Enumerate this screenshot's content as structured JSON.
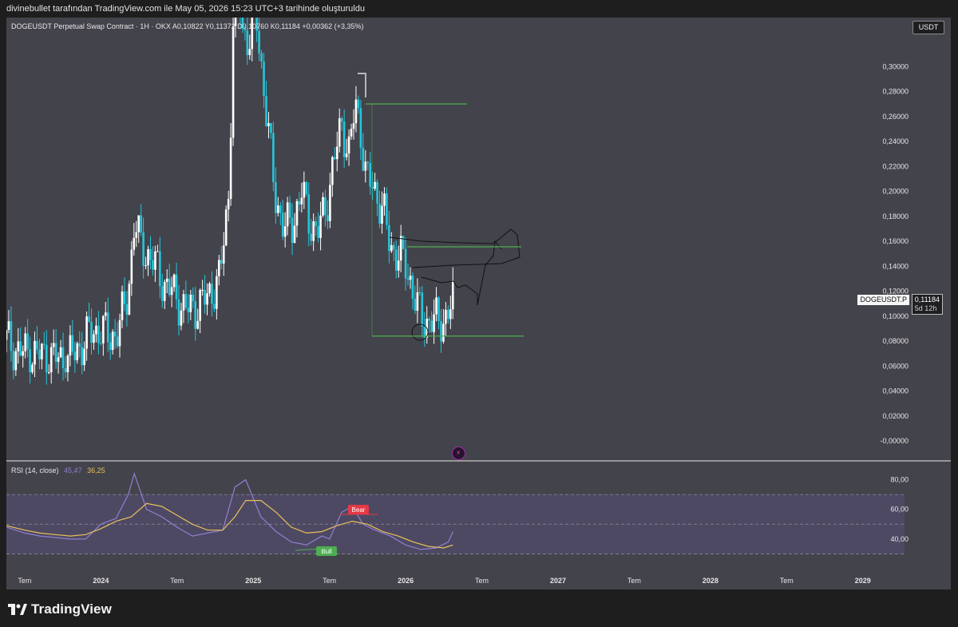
{
  "caption": "divinebullet tarafından TradingView.com ile May 05, 2026 15:23 UTC+3 tarihinde oluşturuldu",
  "legend": {
    "symbol": "DOGEUSDT Perpetual Swap Contract · 1H · OKX",
    "ohlc": "A0,10822  Y0,11372  D0,10760  K0,11184  +0,00362 (+3,35%)"
  },
  "currency": "USDT",
  "price_tag": {
    "symbol": "DOGEUSDT.P",
    "price": "0,11184",
    "countdown": "5d 12h"
  },
  "rsi_legend": {
    "label": "RSI (14, close)",
    "rsi_value": "45,47",
    "ma_value": "36,25"
  },
  "brand": "TradingView",
  "colors": {
    "up": "#ffffff",
    "down": "#26c6da",
    "rsi": "#8f7fd0",
    "rsi_ma": "#e8c05a",
    "level": "#4caf50",
    "bear": "#e53945",
    "bull": "#4caf50",
    "panel": "#43434b"
  },
  "chart_data": [
    {
      "type": "candlestick",
      "ylim": [
        0.0,
        0.32
      ],
      "y_ticks": [
        "0,30000",
        "0,28000",
        "0,26000",
        "0,24000",
        "0,22000",
        "0,20000",
        "0,18000",
        "0,16000",
        "0,14000",
        "0,12000",
        "0,10000",
        "0,08000",
        "0,06000",
        "0,04000",
        "0,02000",
        "-0,00000"
      ],
      "y_tick_values": [
        0.3,
        0.28,
        0.26,
        0.24,
        0.22,
        0.2,
        0.18,
        0.16,
        0.14,
        0.12,
        0.1,
        0.08,
        0.06,
        0.04,
        0.02,
        0.0
      ],
      "x_ticks": [
        "Tem",
        "2024",
        "Tem",
        "2025",
        "Tem",
        "2026",
        "Tem",
        "2027",
        "Tem",
        "2028",
        "Tem",
        "2029"
      ],
      "x_tick_times": [
        2023.5,
        2024.0,
        2024.5,
        2025.0,
        2025.5,
        2026.0,
        2026.5,
        2027.0,
        2027.5,
        2028.0,
        2028.5,
        2029.0
      ],
      "x_range": [
        2023.38,
        2029.3
      ],
      "series_path": [
        [
          2023.38,
          0.081
        ],
        [
          2023.45,
          0.072
        ],
        [
          2023.55,
          0.07
        ],
        [
          2023.65,
          0.068
        ],
        [
          2023.75,
          0.065
        ],
        [
          2023.83,
          0.07
        ],
        [
          2023.92,
          0.085
        ],
        [
          2024.0,
          0.09
        ],
        [
          2024.06,
          0.082
        ],
        [
          2024.12,
          0.09
        ],
        [
          2024.18,
          0.12
        ],
        [
          2024.22,
          0.175
        ],
        [
          2024.26,
          0.158
        ],
        [
          2024.3,
          0.15
        ],
        [
          2024.36,
          0.14
        ],
        [
          2024.42,
          0.125
        ],
        [
          2024.48,
          0.118
        ],
        [
          2024.55,
          0.105
        ],
        [
          2024.62,
          0.107
        ],
        [
          2024.7,
          0.115
        ],
        [
          2024.78,
          0.13
        ],
        [
          2024.84,
          0.2
        ],
        [
          2024.88,
          0.39
        ],
        [
          2024.93,
          0.33
        ],
        [
          2024.97,
          0.32
        ],
        [
          2025.02,
          0.34
        ],
        [
          2025.08,
          0.27
        ],
        [
          2025.14,
          0.2
        ],
        [
          2025.2,
          0.17
        ],
        [
          2025.26,
          0.175
        ],
        [
          2025.32,
          0.2
        ],
        [
          2025.36,
          0.18
        ],
        [
          2025.42,
          0.165
        ],
        [
          2025.48,
          0.19
        ],
        [
          2025.54,
          0.23
        ],
        [
          2025.58,
          0.255
        ],
        [
          2025.63,
          0.23
        ],
        [
          2025.67,
          0.27
        ],
        [
          2025.7,
          0.255
        ],
        [
          2025.74,
          0.21
        ],
        [
          2025.78,
          0.205
        ],
        [
          2025.82,
          0.195
        ],
        [
          2025.86,
          0.18
        ],
        [
          2025.9,
          0.155
        ],
        [
          2025.95,
          0.15
        ],
        [
          2026.0,
          0.14
        ],
        [
          2026.04,
          0.125
        ],
        [
          2026.08,
          0.105
        ],
        [
          2026.12,
          0.095
        ],
        [
          2026.17,
          0.097
        ],
        [
          2026.22,
          0.095
        ],
        [
          2026.27,
          0.1
        ],
        [
          2026.31,
          0.1118
        ]
      ],
      "annotations": [
        "horizontal level 0,2700",
        "horizontal level 0,1555",
        "horizontal level 0,0840",
        "hand-drawn projection"
      ]
    },
    {
      "type": "line",
      "title": "RSI (14, close)",
      "ylim": [
        20,
        90
      ],
      "y_ticks": [
        "80,00",
        "60,00",
        "40,00"
      ],
      "y_tick_values": [
        80,
        60,
        40
      ],
      "band": [
        30,
        70
      ],
      "series": [
        {
          "name": "RSI",
          "x": [
            2023.38,
            2023.5,
            2023.6,
            2023.7,
            2023.8,
            2023.9,
            2024.0,
            2024.1,
            2024.18,
            2024.22,
            2024.3,
            2024.4,
            2024.5,
            2024.6,
            2024.7,
            2024.8,
            2024.88,
            2024.95,
            2025.05,
            2025.15,
            2025.25,
            2025.35,
            2025.45,
            2025.5,
            2025.58,
            2025.65,
            2025.72,
            2025.8,
            2025.9,
            2026.0,
            2026.1,
            2026.2,
            2026.28,
            2026.31
          ],
          "y": [
            48,
            44,
            42,
            41,
            40,
            40,
            50,
            54,
            70,
            84,
            60,
            55,
            48,
            42,
            44,
            46,
            75,
            80,
            55,
            45,
            38,
            36,
            42,
            40,
            58,
            62,
            50,
            46,
            42,
            36,
            33,
            34,
            38,
            45
          ]
        },
        {
          "name": "RSI MA",
          "x": [
            2023.38,
            2023.5,
            2023.6,
            2023.7,
            2023.8,
            2023.9,
            2024.0,
            2024.1,
            2024.2,
            2024.3,
            2024.4,
            2024.5,
            2024.6,
            2024.7,
            2024.8,
            2024.88,
            2024.95,
            2025.05,
            2025.15,
            2025.25,
            2025.35,
            2025.45,
            2025.55,
            2025.65,
            2025.75,
            2025.85,
            2025.95,
            2026.05,
            2026.15,
            2026.25,
            2026.31
          ],
          "y": [
            49,
            46,
            44,
            43,
            42,
            43,
            47,
            52,
            55,
            64,
            62,
            56,
            50,
            46,
            46,
            55,
            66,
            66,
            58,
            48,
            44,
            45,
            49,
            52,
            50,
            45,
            42,
            38,
            35,
            34,
            36
          ]
        }
      ],
      "annotations": [
        {
          "text": "Bear"
        },
        {
          "text": "Bull"
        }
      ]
    }
  ]
}
